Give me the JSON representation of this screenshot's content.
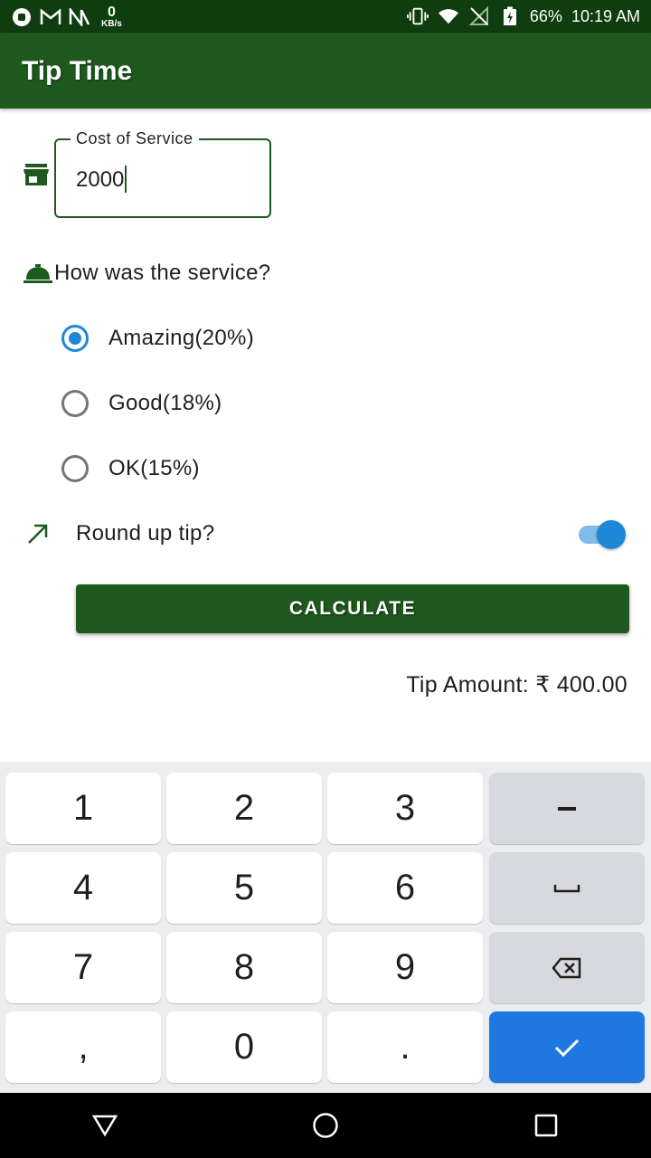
{
  "status_bar": {
    "kb_value": "0",
    "kb_unit": "KB/s",
    "battery": "66%",
    "time": "10:19 AM"
  },
  "app_bar": {
    "title": "Tip Time"
  },
  "cost_field": {
    "label": "Cost of Service",
    "value": "2000"
  },
  "question": "How was the service?",
  "options": [
    {
      "label": "Amazing(20%)",
      "checked": true
    },
    {
      "label": "Good(18%)",
      "checked": false
    },
    {
      "label": "OK(15%)",
      "checked": false
    }
  ],
  "round_up": {
    "label": "Round up tip?",
    "on": true
  },
  "calculate": {
    "label": "CALCULATE"
  },
  "result": {
    "text": "Tip Amount: ₹ 400.00"
  },
  "keyboard": {
    "keys": [
      "1",
      "2",
      "3",
      "4",
      "5",
      "6",
      "7",
      "8",
      "9",
      ",",
      "0",
      "."
    ]
  },
  "colors": {
    "primary": "#1e5a1e",
    "status_bar": "#0f3d0f",
    "accent": "#1e88d6",
    "enter_key": "#1e78e0"
  }
}
